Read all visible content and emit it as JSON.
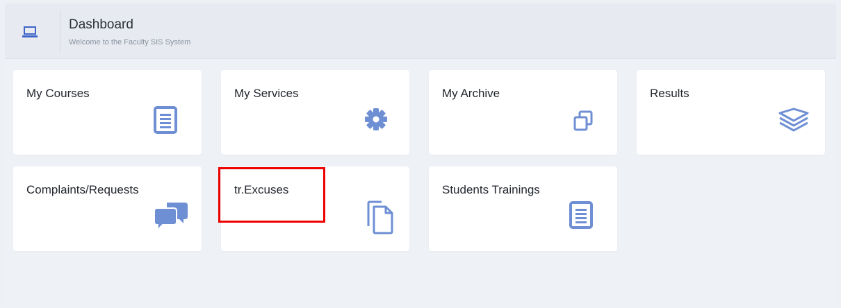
{
  "header": {
    "title": "Dashboard",
    "subtitle": "Welcome to the Faculty SIS System",
    "icon": "laptop-icon"
  },
  "tiles": [
    {
      "label": "My Courses",
      "icon": "document-lines-icon"
    },
    {
      "label": "My Services",
      "icon": "gear-icon"
    },
    {
      "label": "My Archive",
      "icon": "copy-icon"
    },
    {
      "label": "Results",
      "icon": "layers-icon"
    },
    {
      "label": "Complaints/Requests",
      "icon": "chat-bubbles-icon"
    },
    {
      "label": "tr.Excuses",
      "icon": "files-icon"
    },
    {
      "label": "Students Trainings",
      "icon": "document-lines-icon"
    }
  ],
  "colors": {
    "accent": "#6f8fd4",
    "highlight": "#ee0000",
    "background": "#eef1f5"
  }
}
